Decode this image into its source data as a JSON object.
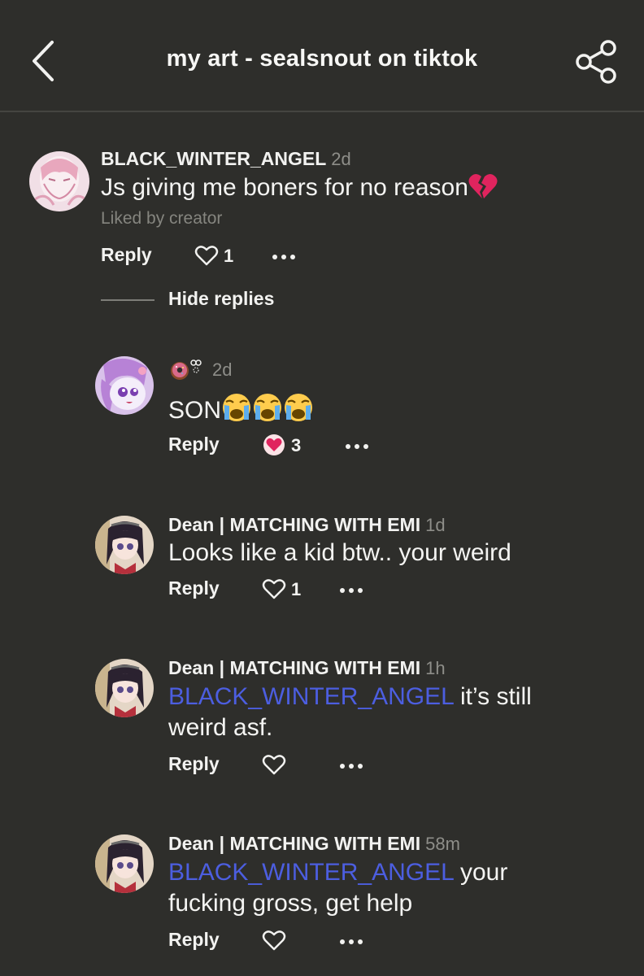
{
  "header": {
    "title": "my art - sealsnout on tiktok"
  },
  "icons": {
    "back": "chevron-left-icon",
    "share": "share-icon",
    "heart": "heart-outline-icon",
    "heart_filled": "heart-filled-icon",
    "more": "more-dots-icon"
  },
  "colors": {
    "background": "#2e2e2b",
    "mention": "#4c5ee0",
    "muted": "#8e8e89"
  },
  "comments": [
    {
      "username": "BLACK_WINTER_ANGEL",
      "time": "2d",
      "text": "Js giving me boners for no reason",
      "emoji": "broken-heart",
      "liked_by": "Liked by creator",
      "reply_label": "Reply",
      "likes": "1",
      "hide_replies_label": "Hide replies"
    },
    {
      "username": "",
      "time": "2d",
      "text": "SON",
      "emoji": "loudly-crying-face x3",
      "reply_label": "Reply",
      "likes": "3"
    },
    {
      "username": "Dean | MATCHING WITH EMI",
      "time": "1d",
      "text": "Looks like a kid btw.. your weird",
      "reply_label": "Reply",
      "likes": "1"
    },
    {
      "username": "Dean | MATCHING WITH EMI",
      "time": "1h",
      "mention": "BLACK_WINTER_ANGEL",
      "text": " it’s still weird asf.",
      "reply_label": "Reply",
      "likes": ""
    },
    {
      "username": "Dean | MATCHING WITH EMI",
      "time": "58m",
      "mention": "BLACK_WINTER_ANGEL",
      "text": " your fucking gross, get help",
      "reply_label": "Reply",
      "likes": ""
    }
  ]
}
